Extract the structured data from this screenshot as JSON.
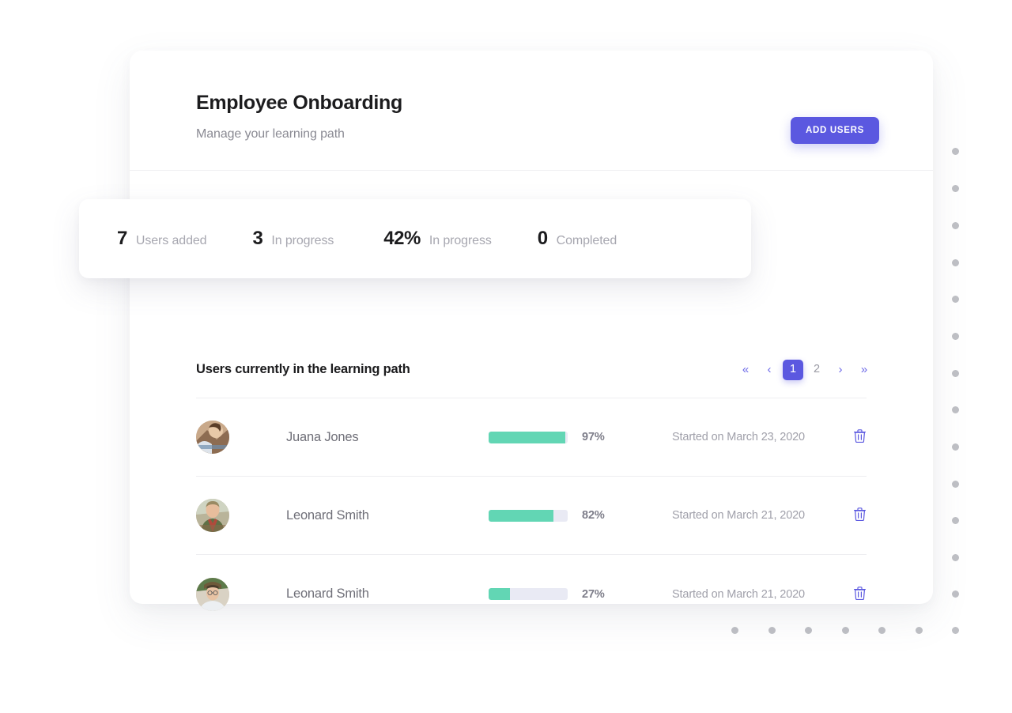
{
  "header": {
    "title": "Employee Onboarding",
    "subtitle": "Manage your learning path",
    "add_users_label": "ADD USERS",
    "accent_color": "#5b58e0"
  },
  "stats": [
    {
      "value": "7",
      "label": "Users added"
    },
    {
      "value": "3",
      "label": "In progress"
    },
    {
      "value": "42%",
      "label": "In progress"
    },
    {
      "value": "0",
      "label": "Completed"
    }
  ],
  "list": {
    "title": "Users currently in the learning path",
    "pagination": {
      "first_label": "«",
      "prev_label": "‹",
      "next_label": "›",
      "last_label": "»",
      "pages": [
        "1",
        "2"
      ],
      "active_page": "1"
    },
    "rows": [
      {
        "name": "Juana Jones",
        "progress": 97,
        "progress_label": "97%",
        "started": "Started on March 23, 2020",
        "avatar": "avatar-photo-juana-jones",
        "delete_icon": "trash-icon"
      },
      {
        "name": "Leonard Smith",
        "progress": 82,
        "progress_label": "82%",
        "started": "Started on March 21, 2020",
        "avatar": "avatar-photo-leonard-smith-1",
        "delete_icon": "trash-icon"
      },
      {
        "name": "Leonard Smith",
        "progress": 27,
        "progress_label": "27%",
        "started": "Started on March 21, 2020",
        "avatar": "avatar-photo-leonard-smith-2",
        "delete_icon": "trash-icon"
      }
    ]
  },
  "decoration": {
    "dot_color": "#bfc0c5",
    "progress_fill_color": "#62d6b4",
    "progress_track_color": "#e9eaf4"
  }
}
